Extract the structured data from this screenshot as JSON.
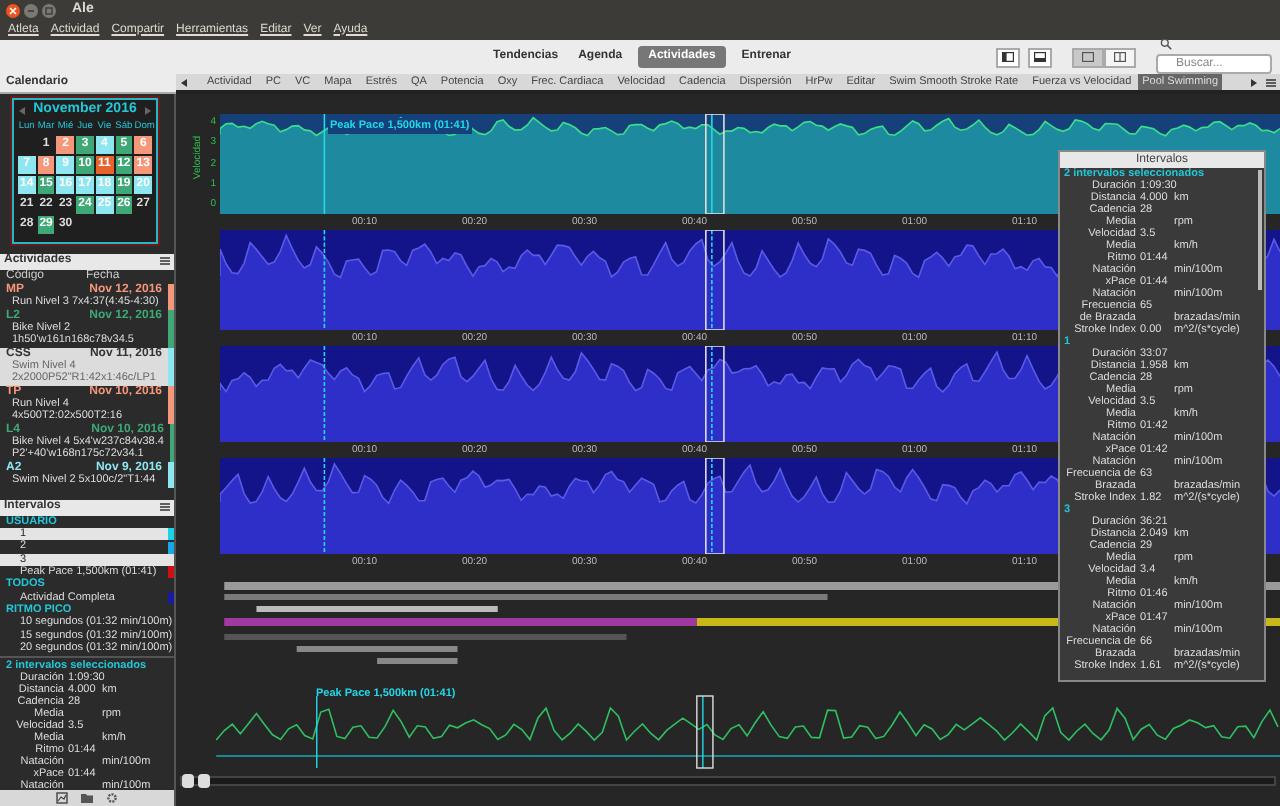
{
  "window": {
    "title": "Ale"
  },
  "menu": [
    "Atleta",
    "Actividad",
    "Compartir",
    "Herramientas",
    "Editar",
    "Ver",
    "Ayuda"
  ],
  "view_tabs": [
    {
      "label": "Tendencias",
      "selected": false
    },
    {
      "label": "Agenda",
      "selected": false
    },
    {
      "label": "Actividades",
      "selected": true
    },
    {
      "label": "Entrenar",
      "selected": false
    }
  ],
  "search": {
    "placeholder": "Buscar..."
  },
  "sidebar": {
    "title": "Calendario",
    "calendar": {
      "month": "November 2016",
      "weekdays": [
        "Lun",
        "Mar",
        "Mié",
        "Jue",
        "Vie",
        "Sáb",
        "Dom"
      ],
      "weeks": [
        [
          {
            "day": "1"
          },
          {
            "day": "2",
            "color": "#f4977a"
          },
          {
            "day": "3",
            "color": "#3fa877"
          },
          {
            "day": "4",
            "color": "#8ee6f0"
          },
          {
            "day": "5",
            "color": "#3fa877"
          },
          {
            "day": "6",
            "color": "#f4977a"
          }
        ],
        [
          {
            "day": "7",
            "color": "#8ee6f0"
          },
          {
            "day": "8",
            "color": "#f4977a"
          },
          {
            "day": "9",
            "color": "#8ee6f0"
          },
          {
            "day": "10",
            "color": "#3fa877"
          },
          {
            "day": "11",
            "color": "#e8632c"
          },
          {
            "day": "12",
            "color": "#3fa877"
          },
          {
            "day": "13",
            "color": "#f4977a"
          }
        ],
        [
          {
            "day": "14",
            "color": "#8ee6f0"
          },
          {
            "day": "15",
            "color": "#3fa877"
          },
          {
            "day": "16",
            "color": "#8ee6f0"
          },
          {
            "day": "17",
            "color": "#8ee6f0"
          },
          {
            "day": "18",
            "color": "#8ee6f0"
          },
          {
            "day": "19",
            "color": "#3fa877"
          },
          {
            "day": "20",
            "color": "#8ee6f0"
          }
        ],
        [
          {
            "day": "21"
          },
          {
            "day": "22"
          },
          {
            "day": "23"
          },
          {
            "day": "24",
            "color": "#3fa877"
          },
          {
            "day": "25",
            "color": "#8ee6f0"
          },
          {
            "day": "26",
            "color": "#3fa877"
          },
          {
            "day": "27"
          }
        ],
        [
          {
            "day": "28"
          },
          {
            "day": "29",
            "color": "#3fa877"
          },
          {
            "day": "30"
          }
        ]
      ]
    },
    "activities": {
      "title": "Actividades",
      "columns": [
        "Código",
        "Fecha"
      ],
      "items": [
        {
          "code": "MP",
          "date": "Nov 12, 2016",
          "lines": [
            "Run Nivel 3 7x4:37(4:45-4:30)"
          ],
          "color": "#f4977a",
          "selected": false
        },
        {
          "code": "L2",
          "date": "Nov 12, 2016",
          "lines": [
            "Bike Nivel 2",
            "1h50'w161n168c78v34.5"
          ],
          "color": "#3fa877",
          "selected": false
        },
        {
          "code": "CSS",
          "date": "Nov 11, 2016",
          "lines": [
            "Swim Nivel 4",
            "2x2000P52\"R1:42x1:46c/LP1"
          ],
          "color": "#8ee6f0",
          "selected": true
        },
        {
          "code": "TP",
          "date": "Nov 10, 2016",
          "lines": [
            "Run Nivel 4",
            "4x500T2:02x500T2:16"
          ],
          "color": "#f4977a",
          "selected": false
        },
        {
          "code": "L4",
          "date": "Nov 10, 2016",
          "lines": [
            "Bike Nivel 4 5x4'w237c84v38.4",
            "P2'+40'w168n175c72v34.1"
          ],
          "color": "#3fa877",
          "selected": false
        },
        {
          "code": "A2",
          "date": "Nov 9, 2016",
          "lines": [
            "Swim Nivel 2 5x100c/2\"T1:44"
          ],
          "color": "#8ee6f0",
          "selected": false
        }
      ]
    },
    "intervals": {
      "title": "Intervalos",
      "groups": [
        {
          "name": "USUARIO",
          "children": [
            {
              "label": "1",
              "selected": true,
              "color": "#19d4e6"
            },
            {
              "label": "2",
              "selected": false,
              "color": "#19a8e6"
            },
            {
              "label": "3",
              "selected": true
            },
            {
              "label": "Peak Pace 1,500km (01:41)",
              "selected": false,
              "color": "#d01010"
            }
          ]
        },
        {
          "name": "TODOS",
          "children": [
            {
              "label": "Actividad Completa",
              "selected": false,
              "color": "#1a1a9a"
            }
          ]
        },
        {
          "name": "RITMO PICO",
          "children": [
            {
              "label": "10 segundos (01:32 min/100m)",
              "selected": false
            },
            {
              "label": "15 segundos (01:32 min/100m)",
              "selected": false
            },
            {
              "label": "20 segundos (01:32 min/100m)",
              "selected": false
            }
          ]
        }
      ]
    },
    "summary": {
      "heading": "2 intervalos seleccionados",
      "rows": [
        {
          "label": "Duración",
          "value": "1:09:30"
        },
        {
          "label": "Distancia",
          "value": "4.000",
          "unit": "km"
        },
        {
          "label": "Cadencia",
          "value": "28"
        },
        {
          "label": "Media",
          "unit": "rpm"
        },
        {
          "label": "Velocidad",
          "value": "3.5"
        },
        {
          "label": "Media",
          "unit": "km/h"
        },
        {
          "label": "Ritmo",
          "value": "01:44"
        },
        {
          "label": "Natación",
          "unit": "min/100m"
        },
        {
          "label": "xPace",
          "value": "01:44"
        },
        {
          "label": "Natación",
          "unit": "min/100m"
        }
      ]
    }
  },
  "chart_tabs": [
    {
      "label": "Actividad",
      "selected": false
    },
    {
      "label": "PC",
      "selected": false
    },
    {
      "label": "VC",
      "selected": false
    },
    {
      "label": "Mapa",
      "selected": false
    },
    {
      "label": "Estrés",
      "selected": false
    },
    {
      "label": "QA",
      "selected": false
    },
    {
      "label": "Potencia",
      "selected": false
    },
    {
      "label": "Oxy",
      "selected": false
    },
    {
      "label": "Frec. Cardiaca",
      "selected": false
    },
    {
      "label": "Velocidad",
      "selected": false
    },
    {
      "label": "Cadencia",
      "selected": false
    },
    {
      "label": "Dispersión",
      "selected": false
    },
    {
      "label": "HrPw",
      "selected": false
    },
    {
      "label": "Editar",
      "selected": false
    },
    {
      "label": "Swim Smooth Stroke Rate",
      "selected": false
    },
    {
      "label": "Fuerza vs Velocidad",
      "selected": false
    },
    {
      "label": "Pool Swimming",
      "selected": true
    }
  ],
  "charts": {
    "marker_label": "Peak Pace 1,500km (01:41)",
    "ylabel": "Velocidad",
    "yticks": [
      "4",
      "3",
      "2",
      "1",
      "0"
    ],
    "panels": [
      {
        "xticks": [
          "00:10",
          "00:20",
          "00:30",
          "00:40",
          "00:50",
          "01:00",
          "01:10"
        ]
      },
      {
        "xticks": [
          "00:10",
          "00:20",
          "00:30",
          "00:40",
          "00:50",
          "01:00",
          "01:10"
        ]
      },
      {
        "xticks": [
          "00:10",
          "00:20",
          "00:30",
          "00:40",
          "00:50",
          "01:00",
          "01:10"
        ]
      },
      {
        "xticks": [
          "00:10",
          "00:20",
          "00:30",
          "00:40",
          "00:50",
          "01:00",
          "01:10"
        ]
      }
    ],
    "overview_label": "Peak Pace 1,500km (01:41)"
  },
  "intervals_panel": {
    "title": "Intervalos",
    "sections": [
      {
        "heading": "2 intervalos seleccionados",
        "rows": [
          {
            "label": "Duración",
            "value": "1:09:30"
          },
          {
            "label": "Distancia",
            "value": "4.000",
            "unit": "km"
          },
          {
            "label": "Cadencia",
            "value": "28"
          },
          {
            "label": "Media",
            "unit": "rpm"
          },
          {
            "label": "Velocidad",
            "value": "3.5"
          },
          {
            "label": "Media",
            "unit": "km/h"
          },
          {
            "label": "Ritmo",
            "value": "01:44"
          },
          {
            "label": "Natación",
            "unit": "min/100m"
          },
          {
            "label": "xPace",
            "value": "01:44"
          },
          {
            "label": "Natación",
            "unit": "min/100m"
          },
          {
            "label": "Frecuencia",
            "value": "65"
          },
          {
            "label": "de Brazada",
            "unit": "brazadas/min"
          },
          {
            "label": "Stroke Index",
            "value": "0.00",
            "unit": "m^2/(s*cycle)"
          }
        ]
      },
      {
        "heading": "1",
        "rows": [
          {
            "label": "Duración",
            "value": "33:07"
          },
          {
            "label": "Distancia",
            "value": "1.958",
            "unit": "km"
          },
          {
            "label": "Cadencia",
            "value": "28"
          },
          {
            "label": "Media",
            "unit": "rpm"
          },
          {
            "label": "Velocidad",
            "value": "3.5"
          },
          {
            "label": "Media",
            "unit": "km/h"
          },
          {
            "label": "Ritmo",
            "value": "01:42"
          },
          {
            "label": "Natación",
            "unit": "min/100m"
          },
          {
            "label": "xPace",
            "value": "01:42"
          },
          {
            "label": "Natación",
            "unit": "min/100m"
          },
          {
            "label": "Frecuencia de",
            "value": "63"
          },
          {
            "label": "Brazada",
            "unit": "brazadas/min"
          },
          {
            "label": "Stroke Index",
            "value": "1.82",
            "unit": "m^2/(s*cycle)"
          }
        ]
      },
      {
        "heading": "3",
        "rows": [
          {
            "label": "Duración",
            "value": "36:21"
          },
          {
            "label": "Distancia",
            "value": "2.049",
            "unit": "km"
          },
          {
            "label": "Cadencia",
            "value": "29"
          },
          {
            "label": "Media",
            "unit": "rpm"
          },
          {
            "label": "Velocidad",
            "value": "3.4"
          },
          {
            "label": "Media",
            "unit": "km/h"
          },
          {
            "label": "Ritmo",
            "value": "01:46"
          },
          {
            "label": "Natación",
            "unit": "min/100m"
          },
          {
            "label": "xPace",
            "value": "01:47"
          },
          {
            "label": "Natación",
            "unit": "min/100m"
          },
          {
            "label": "Frecuencia de",
            "value": "66"
          },
          {
            "label": "Brazada",
            "unit": "brazadas/min"
          },
          {
            "label": "Stroke Index",
            "value": "1.61",
            "unit": "m^2/(s*cycle)"
          }
        ]
      }
    ]
  }
}
